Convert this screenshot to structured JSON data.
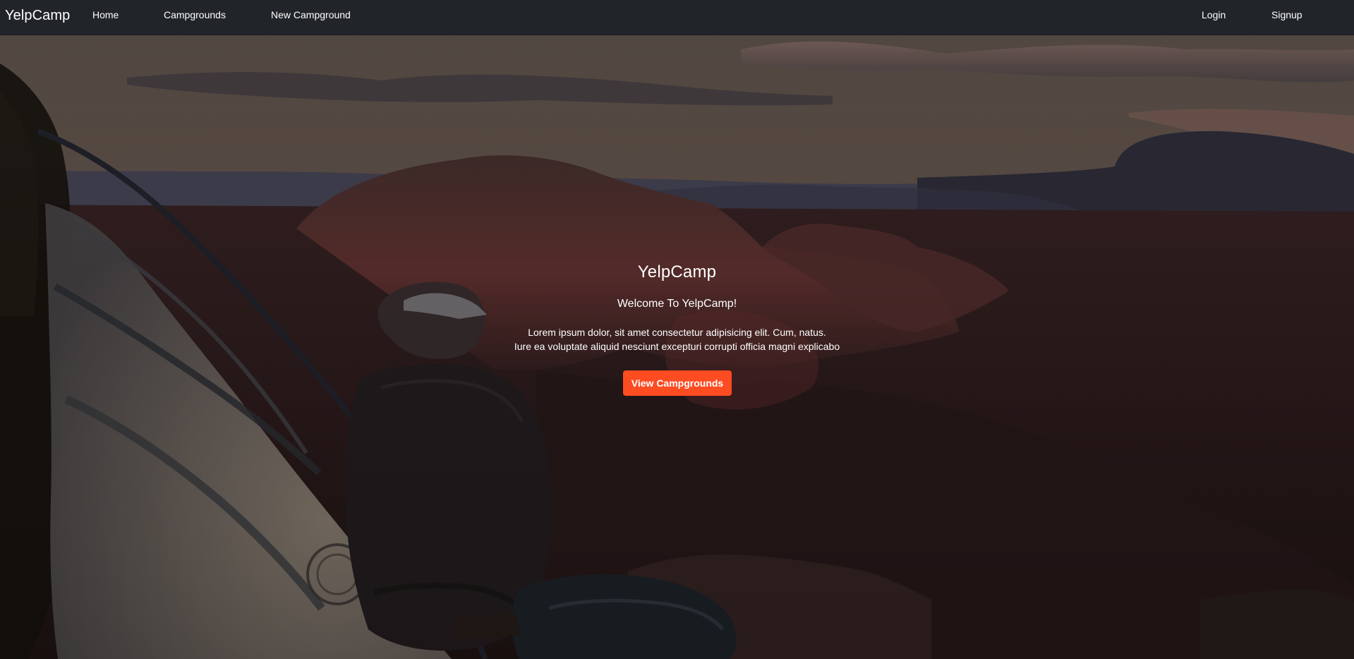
{
  "navbar": {
    "brand": "YelpCamp",
    "links": {
      "home": "Home",
      "campgrounds": "Campgrounds",
      "new_campground": "New Campground",
      "login": "Login",
      "signup": "Signup"
    },
    "background": "#212529"
  },
  "hero": {
    "title": "YelpCamp",
    "subtitle": "Welcome To YelpCamp!",
    "text_line_1": "Lorem ipsum dolor, sit amet consectetur adipisicing elit. Cum, natus.",
    "text_line_2": "Iure ea voluptate aliquid nesciunt excepturi corrupti officia magni explicabo",
    "button_label": "View Campgrounds",
    "button_color": "#fd4b22",
    "image_description": "person"
  }
}
